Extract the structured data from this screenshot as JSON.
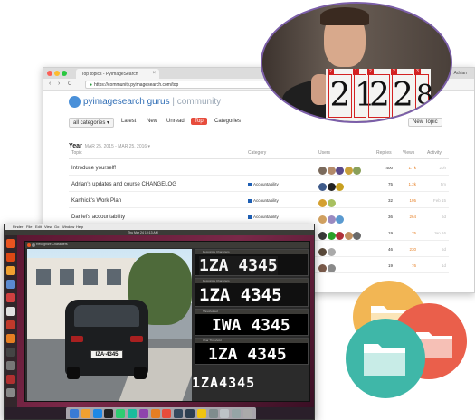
{
  "browser": {
    "tab_title": "Top topics - PyImageSearch",
    "tab_close": "×",
    "profile": "Adrian",
    "nav_back": "‹",
    "nav_forward": "›",
    "nav_reload": "C",
    "url": "https://community.pyimagesearch.com/top"
  },
  "site": {
    "logo_main": "pyimagesearch gurus",
    "logo_sub": "| community"
  },
  "nav": {
    "categories_dropdown": "all categories ▾",
    "latest": "Latest",
    "new": "New",
    "unread": "Unread",
    "top": "Top",
    "categories": "Categories",
    "new_topic": "New Topic"
  },
  "period": {
    "label": "Year",
    "range": "MAR 25, 2015 - MAR 25, 2016 ▾"
  },
  "columns": {
    "topic": "Topic",
    "category": "Category",
    "users": "Users",
    "replies": "Replies",
    "views": "Views",
    "activity": "Activity"
  },
  "topics": [
    {
      "title": "Introduce yourself!",
      "category": "",
      "replies": "400",
      "views": "1.7k",
      "activity": "20h",
      "users": [
        "#7a6a5c",
        "#b38a6a",
        "#5a4a8a",
        "#c9a03a",
        "#8aa05a"
      ]
    },
    {
      "title": "Adrian's updates and course CHANGELOG",
      "category": "Accountability",
      "replies": "75",
      "views": "1.2k",
      "activity": "5m",
      "users": [
        "#3e5a8a",
        "#222222",
        "#c8a020"
      ]
    },
    {
      "title": "Karthick's Work Plan",
      "category": "Accountability",
      "replies": "32",
      "views": "195",
      "activity": "Feb 15",
      "users": [
        "#d4a030",
        "#a8c060"
      ]
    },
    {
      "title": "Daniel's accountability",
      "category": "Accountability",
      "replies": "36",
      "views": "264",
      "activity": "6d",
      "users": [
        "#d0a060",
        "#9a8ac0",
        "#5a9ad0"
      ]
    },
    {
      "title": "",
      "category": "",
      "replies": "19",
      "views": "75",
      "activity": "Jan 16",
      "users": [
        "#3a3a3a",
        "#2aa02a",
        "#b0303a",
        "#c09060",
        "#6a6a6a"
      ]
    },
    {
      "title": "",
      "category": "",
      "replies": "46",
      "views": "230",
      "activity": "5d",
      "users": [
        "#5a4a3a",
        "#aaaaaa"
      ]
    },
    {
      "title": "",
      "category": "",
      "replies": "19",
      "views": "76",
      "activity": "1d",
      "users": [
        "#7a5a4a",
        "#8a8a8a"
      ]
    }
  ],
  "photo": {
    "digits": [
      "2",
      "1",
      "2",
      "2",
      "8"
    ],
    "boxes": [
      "2",
      "1",
      "2",
      "2",
      "3"
    ]
  },
  "desktop": {
    "menu": [
      "Finder",
      "File",
      "Edit",
      "View",
      "Go",
      "Window",
      "Help"
    ],
    "ubuntu_title": "Thu Mar 24 10:13 AM",
    "window_title": "Recognize Characters",
    "plate_photo": "ΙΖΑ·4345",
    "panels": [
      {
        "title": "Recognize Characters",
        "text": "1ZA 4345"
      },
      {
        "title": "Recognize Characters",
        "text": "1ZA 4345"
      },
      {
        "title": "Thresholded",
        "text": "IWA 4345"
      },
      {
        "title": "Char Threshold",
        "text": "1ZA 4345"
      }
    ],
    "result": "1ZA4345"
  },
  "colors": {
    "accent_red": "#e74c3c",
    "link_blue": "#2f6db5",
    "box_red": "#d32222",
    "oval_border": "#7b5ea8",
    "folder_orange": "#f2b654",
    "folder_red": "#ea5f4b",
    "folder_teal": "#3fb7a8"
  }
}
